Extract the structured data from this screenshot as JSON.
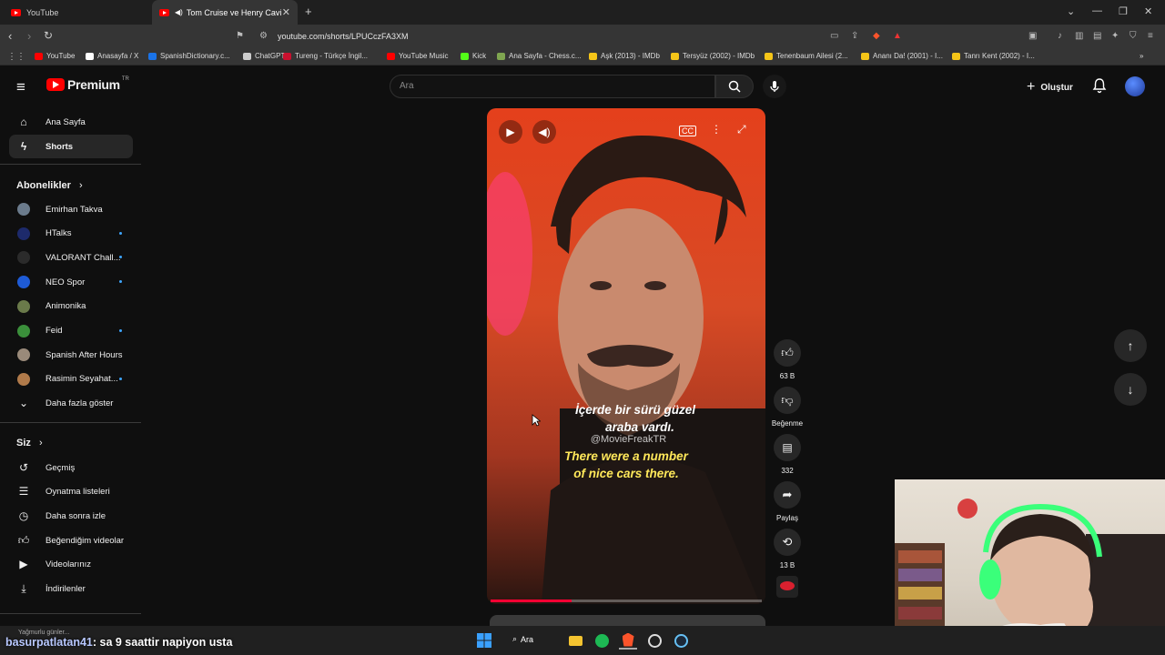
{
  "browser": {
    "tabs": [
      {
        "label": "YouTube"
      },
      {
        "label": "Tom Cruise ve Henry Cavill Fa"
      }
    ],
    "url": "youtube.com/shorts/LPUCczFA3XM",
    "bookmarks": [
      {
        "label": "YouTube",
        "color": "#ff0000"
      },
      {
        "label": "Anasayfa / X",
        "color": "#ffffff"
      },
      {
        "label": "SpanishDictionary.c...",
        "color": "#1a73e8"
      },
      {
        "label": "ChatGPT",
        "color": "#cccccc"
      },
      {
        "label": "Tureng - Türkçe İngil...",
        "color": "#c8102e"
      },
      {
        "label": "YouTube Music",
        "color": "#ff0000"
      },
      {
        "label": "Kick",
        "color": "#53fc18"
      },
      {
        "label": "Ana Sayfa - Chess.c...",
        "color": "#7fa650"
      },
      {
        "label": "Aşk (2013) - IMDb",
        "color": "#f5c518"
      },
      {
        "label": "Tersyüz (2002) - IMDb",
        "color": "#f5c518"
      },
      {
        "label": "Tenenbaum Ailesi (2...",
        "color": "#f5c518"
      },
      {
        "label": "Ananı Da! (2001) - I...",
        "color": "#f5c518"
      },
      {
        "label": "Tanrı Kent (2002) - I...",
        "color": "#f5c518"
      }
    ]
  },
  "header": {
    "logo_text": "Premium",
    "logo_region": "TR",
    "search_placeholder": "Ara",
    "create_label": "Oluştur"
  },
  "sidebar": {
    "main": [
      {
        "label": "Ana Sayfa",
        "icon": "home-icon"
      },
      {
        "label": "Shorts",
        "icon": "shorts-icon"
      }
    ],
    "subscriptions_title": "Abonelikler",
    "subscriptions": [
      {
        "label": "Emirhan Takva",
        "color": "#6b7b8c",
        "dot": false
      },
      {
        "label": "HTalks",
        "color": "#1d2a6b",
        "dot": true
      },
      {
        "label": "VALORANT Chall...",
        "color": "#2b2b2b",
        "dot": true
      },
      {
        "label": "NEO Spor",
        "color": "#1e5bd6",
        "dot": true
      },
      {
        "label": "Animonika",
        "color": "#6a7a4a",
        "dot": false
      },
      {
        "label": "Feid",
        "color": "#3b8f3b",
        "dot": true
      },
      {
        "label": "Spanish After Hours",
        "color": "#9a8a7a",
        "dot": false
      },
      {
        "label": "Rasimin Seyahat...",
        "color": "#b07a4a",
        "dot": true
      }
    ],
    "show_more": "Daha fazla göster",
    "you_title": "Siz",
    "you_items": [
      {
        "label": "Geçmiş",
        "icon": "history-icon"
      },
      {
        "label": "Oynatma listeleri",
        "icon": "playlists-icon"
      },
      {
        "label": "Daha sonra izle",
        "icon": "watch-later-icon"
      },
      {
        "label": "Beğendiğim videolar",
        "icon": "liked-icon"
      },
      {
        "label": "Videolarınız",
        "icon": "your-videos-icon"
      },
      {
        "label": "İndirilenler",
        "icon": "downloads-icon"
      }
    ]
  },
  "video": {
    "subtitle_tr_1": "İçerde bir sürü güzel",
    "subtitle_tr_2": "araba vardı.",
    "watermark": "@MovieFreakTR",
    "subtitle_en_1": "There were a number",
    "subtitle_en_2": "of nice cars there.",
    "progress": 0.3
  },
  "actions": {
    "likes": "63 B",
    "dislike_label": "Beğenme",
    "comments": "332",
    "share_label": "Paylaş",
    "remix_count": "13 B"
  },
  "stream": {
    "chat_user": "basurpatlatan41",
    "chat_message": ": sa 9 saattir napiyon usta",
    "weather": "Yağmurlu günler..."
  },
  "taskbar": {
    "search_label": "Ara"
  }
}
